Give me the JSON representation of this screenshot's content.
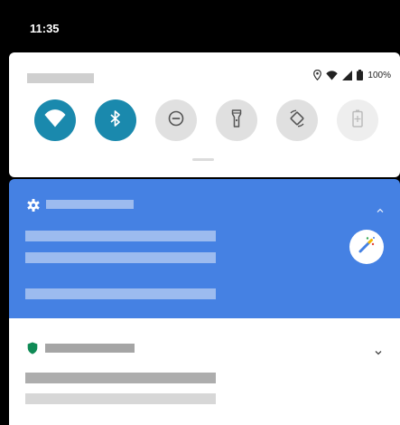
{
  "status_bar": {
    "time": "11:35"
  },
  "quick_settings": {
    "battery_percent": "100%",
    "tiles": [
      {
        "name": "wifi-tile",
        "icon": "wifi-icon",
        "state": "on"
      },
      {
        "name": "bluetooth-tile",
        "icon": "bluetooth-icon",
        "state": "on"
      },
      {
        "name": "dnd-tile",
        "icon": "do-not-disturb-icon",
        "state": "off"
      },
      {
        "name": "flashlight-tile",
        "icon": "flashlight-icon",
        "state": "off"
      },
      {
        "name": "auto-rotate-tile",
        "icon": "auto-rotate-icon",
        "state": "off"
      },
      {
        "name": "battery-saver-tile",
        "icon": "battery-saver-icon",
        "state": "unavailable"
      }
    ]
  },
  "notifications": [
    {
      "name": "settings-notification",
      "icon": "gear-icon",
      "accent": "#4581e3",
      "expanded": true,
      "action_icon": "magic-wand-icon"
    },
    {
      "name": "security-notification",
      "icon": "shield-icon",
      "accent": "#0f8a55",
      "expanded": false
    }
  ],
  "colors": {
    "tile_active": "#1a89ad",
    "tile_inactive": "#e0e0e0",
    "notification_blue": "#4581e3",
    "placeholder_text": "#cfcfcf"
  }
}
